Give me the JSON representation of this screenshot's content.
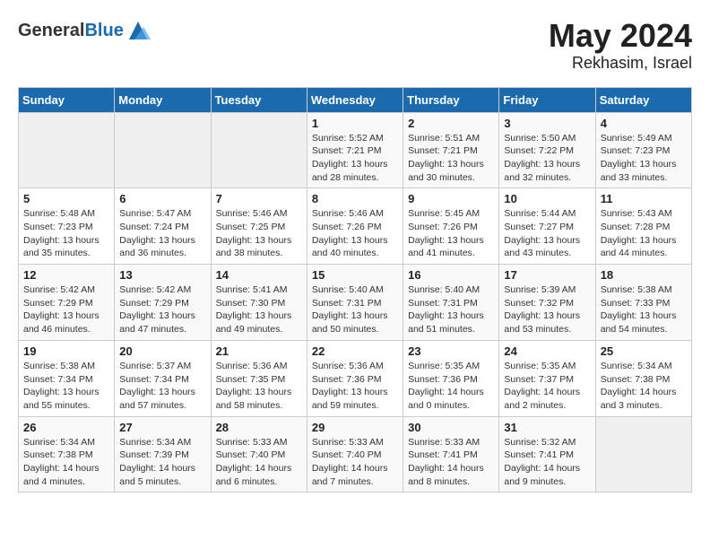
{
  "header": {
    "logo_general": "General",
    "logo_blue": "Blue",
    "month_year": "May 2024",
    "location": "Rekhasim, Israel"
  },
  "days_of_week": [
    "Sunday",
    "Monday",
    "Tuesday",
    "Wednesday",
    "Thursday",
    "Friday",
    "Saturday"
  ],
  "weeks": [
    [
      {
        "day": "",
        "sunrise": "",
        "sunset": "",
        "daylight": ""
      },
      {
        "day": "",
        "sunrise": "",
        "sunset": "",
        "daylight": ""
      },
      {
        "day": "",
        "sunrise": "",
        "sunset": "",
        "daylight": ""
      },
      {
        "day": "1",
        "sunrise": "Sunrise: 5:52 AM",
        "sunset": "Sunset: 7:21 PM",
        "daylight": "Daylight: 13 hours and 28 minutes."
      },
      {
        "day": "2",
        "sunrise": "Sunrise: 5:51 AM",
        "sunset": "Sunset: 7:21 PM",
        "daylight": "Daylight: 13 hours and 30 minutes."
      },
      {
        "day": "3",
        "sunrise": "Sunrise: 5:50 AM",
        "sunset": "Sunset: 7:22 PM",
        "daylight": "Daylight: 13 hours and 32 minutes."
      },
      {
        "day": "4",
        "sunrise": "Sunrise: 5:49 AM",
        "sunset": "Sunset: 7:23 PM",
        "daylight": "Daylight: 13 hours and 33 minutes."
      }
    ],
    [
      {
        "day": "5",
        "sunrise": "Sunrise: 5:48 AM",
        "sunset": "Sunset: 7:23 PM",
        "daylight": "Daylight: 13 hours and 35 minutes."
      },
      {
        "day": "6",
        "sunrise": "Sunrise: 5:47 AM",
        "sunset": "Sunset: 7:24 PM",
        "daylight": "Daylight: 13 hours and 36 minutes."
      },
      {
        "day": "7",
        "sunrise": "Sunrise: 5:46 AM",
        "sunset": "Sunset: 7:25 PM",
        "daylight": "Daylight: 13 hours and 38 minutes."
      },
      {
        "day": "8",
        "sunrise": "Sunrise: 5:46 AM",
        "sunset": "Sunset: 7:26 PM",
        "daylight": "Daylight: 13 hours and 40 minutes."
      },
      {
        "day": "9",
        "sunrise": "Sunrise: 5:45 AM",
        "sunset": "Sunset: 7:26 PM",
        "daylight": "Daylight: 13 hours and 41 minutes."
      },
      {
        "day": "10",
        "sunrise": "Sunrise: 5:44 AM",
        "sunset": "Sunset: 7:27 PM",
        "daylight": "Daylight: 13 hours and 43 minutes."
      },
      {
        "day": "11",
        "sunrise": "Sunrise: 5:43 AM",
        "sunset": "Sunset: 7:28 PM",
        "daylight": "Daylight: 13 hours and 44 minutes."
      }
    ],
    [
      {
        "day": "12",
        "sunrise": "Sunrise: 5:42 AM",
        "sunset": "Sunset: 7:29 PM",
        "daylight": "Daylight: 13 hours and 46 minutes."
      },
      {
        "day": "13",
        "sunrise": "Sunrise: 5:42 AM",
        "sunset": "Sunset: 7:29 PM",
        "daylight": "Daylight: 13 hours and 47 minutes."
      },
      {
        "day": "14",
        "sunrise": "Sunrise: 5:41 AM",
        "sunset": "Sunset: 7:30 PM",
        "daylight": "Daylight: 13 hours and 49 minutes."
      },
      {
        "day": "15",
        "sunrise": "Sunrise: 5:40 AM",
        "sunset": "Sunset: 7:31 PM",
        "daylight": "Daylight: 13 hours and 50 minutes."
      },
      {
        "day": "16",
        "sunrise": "Sunrise: 5:40 AM",
        "sunset": "Sunset: 7:31 PM",
        "daylight": "Daylight: 13 hours and 51 minutes."
      },
      {
        "day": "17",
        "sunrise": "Sunrise: 5:39 AM",
        "sunset": "Sunset: 7:32 PM",
        "daylight": "Daylight: 13 hours and 53 minutes."
      },
      {
        "day": "18",
        "sunrise": "Sunrise: 5:38 AM",
        "sunset": "Sunset: 7:33 PM",
        "daylight": "Daylight: 13 hours and 54 minutes."
      }
    ],
    [
      {
        "day": "19",
        "sunrise": "Sunrise: 5:38 AM",
        "sunset": "Sunset: 7:34 PM",
        "daylight": "Daylight: 13 hours and 55 minutes."
      },
      {
        "day": "20",
        "sunrise": "Sunrise: 5:37 AM",
        "sunset": "Sunset: 7:34 PM",
        "daylight": "Daylight: 13 hours and 57 minutes."
      },
      {
        "day": "21",
        "sunrise": "Sunrise: 5:36 AM",
        "sunset": "Sunset: 7:35 PM",
        "daylight": "Daylight: 13 hours and 58 minutes."
      },
      {
        "day": "22",
        "sunrise": "Sunrise: 5:36 AM",
        "sunset": "Sunset: 7:36 PM",
        "daylight": "Daylight: 13 hours and 59 minutes."
      },
      {
        "day": "23",
        "sunrise": "Sunrise: 5:35 AM",
        "sunset": "Sunset: 7:36 PM",
        "daylight": "Daylight: 14 hours and 0 minutes."
      },
      {
        "day": "24",
        "sunrise": "Sunrise: 5:35 AM",
        "sunset": "Sunset: 7:37 PM",
        "daylight": "Daylight: 14 hours and 2 minutes."
      },
      {
        "day": "25",
        "sunrise": "Sunrise: 5:34 AM",
        "sunset": "Sunset: 7:38 PM",
        "daylight": "Daylight: 14 hours and 3 minutes."
      }
    ],
    [
      {
        "day": "26",
        "sunrise": "Sunrise: 5:34 AM",
        "sunset": "Sunset: 7:38 PM",
        "daylight": "Daylight: 14 hours and 4 minutes."
      },
      {
        "day": "27",
        "sunrise": "Sunrise: 5:34 AM",
        "sunset": "Sunset: 7:39 PM",
        "daylight": "Daylight: 14 hours and 5 minutes."
      },
      {
        "day": "28",
        "sunrise": "Sunrise: 5:33 AM",
        "sunset": "Sunset: 7:40 PM",
        "daylight": "Daylight: 14 hours and 6 minutes."
      },
      {
        "day": "29",
        "sunrise": "Sunrise: 5:33 AM",
        "sunset": "Sunset: 7:40 PM",
        "daylight": "Daylight: 14 hours and 7 minutes."
      },
      {
        "day": "30",
        "sunrise": "Sunrise: 5:33 AM",
        "sunset": "Sunset: 7:41 PM",
        "daylight": "Daylight: 14 hours and 8 minutes."
      },
      {
        "day": "31",
        "sunrise": "Sunrise: 5:32 AM",
        "sunset": "Sunset: 7:41 PM",
        "daylight": "Daylight: 14 hours and 9 minutes."
      },
      {
        "day": "",
        "sunrise": "",
        "sunset": "",
        "daylight": ""
      }
    ]
  ]
}
